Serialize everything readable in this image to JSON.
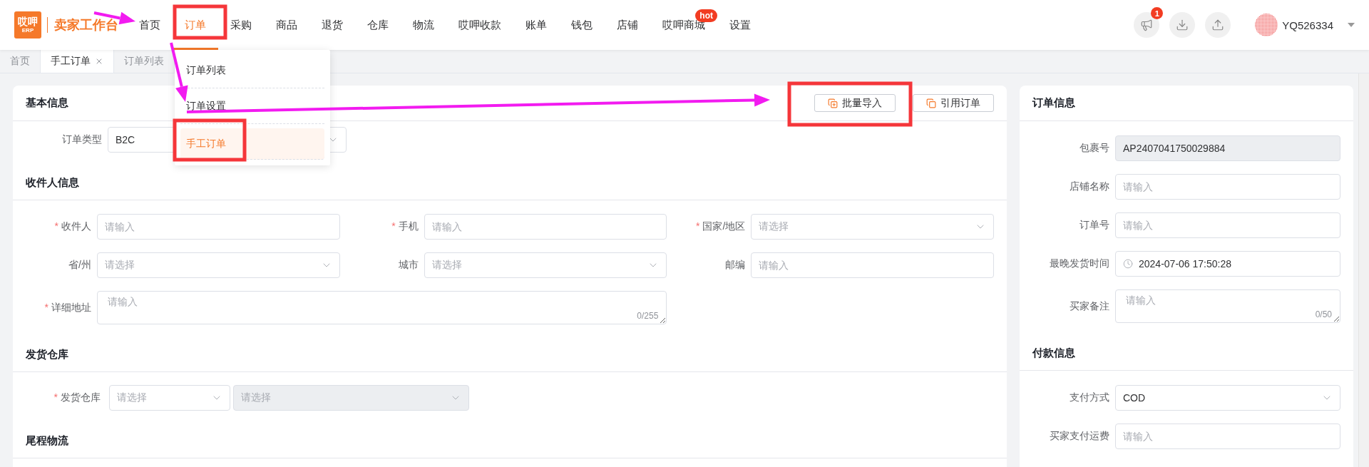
{
  "header": {
    "logo": {
      "mark": "哎呷",
      "badge": "ERP"
    },
    "brand": "卖家工作台",
    "nav": [
      {
        "label": "首页",
        "selected": false
      },
      {
        "label": "订单",
        "selected": true
      },
      {
        "label": "采购",
        "selected": false
      },
      {
        "label": "商品",
        "selected": false
      },
      {
        "label": "退货",
        "selected": false
      },
      {
        "label": "仓库",
        "selected": false
      },
      {
        "label": "物流",
        "selected": false
      },
      {
        "label": "哎呷收款",
        "selected": false
      },
      {
        "label": "账单",
        "selected": false
      },
      {
        "label": "钱包",
        "selected": false
      },
      {
        "label": "店铺",
        "selected": false
      },
      {
        "label": "哎呷商城",
        "selected": false,
        "badge": "hot"
      },
      {
        "label": "设置",
        "selected": false
      }
    ],
    "notification_count": "1",
    "user": "YQ526334"
  },
  "tabs": [
    {
      "label": "首页",
      "selected": false,
      "closable": false
    },
    {
      "label": "手工订单",
      "selected": true,
      "closable": true
    },
    {
      "label": "订单列表",
      "selected": false,
      "closable": false
    }
  ],
  "dropdown": {
    "items": [
      {
        "label": "订单列表",
        "selected": false
      },
      {
        "label": "订单设置",
        "selected": false
      },
      {
        "label": "手工订单",
        "selected": true
      }
    ]
  },
  "basic_info": {
    "title": "基本信息",
    "buttons": [
      {
        "label": "批量导入",
        "kind": "import"
      },
      {
        "label": "引用订单",
        "kind": "copy"
      }
    ],
    "order_type": {
      "label": "订单类型",
      "kind": "select",
      "value": "B2C"
    }
  },
  "recipient": {
    "title": "收件人信息",
    "fields": [
      {
        "label": "收件人",
        "required_mark": "*",
        "kind": "input",
        "placeholder": "请输入"
      },
      {
        "label": "手机",
        "required_mark": "*",
        "kind": "input",
        "placeholder": "请输入"
      },
      {
        "label": "国家/地区",
        "required_mark": "*",
        "kind": "select",
        "placeholder": "请选择"
      },
      {
        "label": "省/州",
        "kind": "select",
        "placeholder": "请选择"
      },
      {
        "label": "城市",
        "kind": "select",
        "placeholder": "请选择"
      },
      {
        "label": "邮编",
        "kind": "input",
        "placeholder": "请输入"
      }
    ],
    "address": {
      "label": "详细地址",
      "required_mark": "*",
      "kind": "textarea",
      "placeholder": "请输入",
      "counter": "0/255"
    }
  },
  "warehouse": {
    "title": "发货仓库",
    "label": "发货仓库",
    "required_mark": "*",
    "selects": [
      {
        "kind": "select",
        "placeholder": "请选择",
        "disabled": false
      },
      {
        "kind": "select",
        "placeholder": "请选择",
        "disabled": true
      }
    ]
  },
  "last_mile": {
    "title": "尾程物流"
  },
  "order_info": {
    "title": "订单信息",
    "fields": [
      {
        "label": "包裹号",
        "kind": "input",
        "value": "AP2407041750029884",
        "disabled": true
      },
      {
        "label": "店铺名称",
        "kind": "input",
        "placeholder": "请输入",
        "disabled": false
      },
      {
        "label": "订单号",
        "kind": "input",
        "placeholder": "请输入",
        "disabled": false
      },
      {
        "label": "最晚发货时间",
        "kind": "datetime",
        "value": "2024-07-06 17:50:28",
        "disabled": false
      },
      {
        "label": "买家备注",
        "kind": "textarea",
        "placeholder": "请输入",
        "counter": "0/50",
        "disabled": false
      }
    ]
  },
  "payment_info": {
    "title": "付款信息",
    "fields": [
      {
        "label": "支付方式",
        "kind": "select",
        "value": "COD",
        "disabled": false
      },
      {
        "label": "买家支付运费",
        "kind": "input",
        "placeholder": "请输入",
        "disabled": false
      }
    ]
  }
}
